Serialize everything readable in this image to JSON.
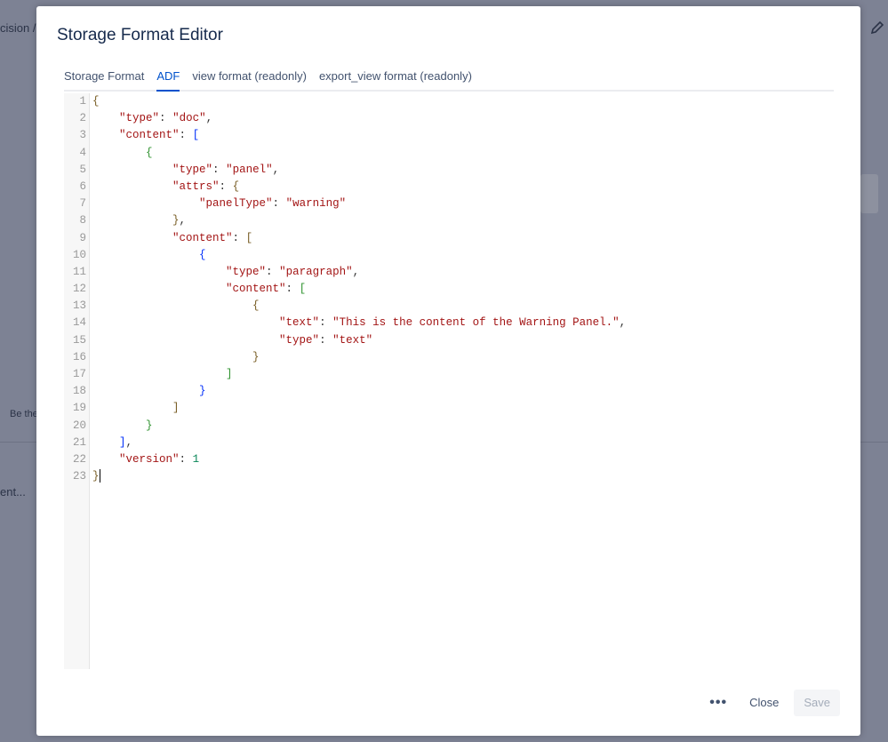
{
  "background": {
    "breadcrumb_fragment": "cision  /",
    "comment_prompt": "Be the",
    "content_fragment": "ent..."
  },
  "modal": {
    "title": "Storage Format Editor",
    "tabs": [
      {
        "label": "Storage Format",
        "active": false
      },
      {
        "label": "ADF",
        "active": true
      },
      {
        "label": "view format (readonly)",
        "active": false
      },
      {
        "label": "export_view format (readonly)",
        "active": false
      }
    ],
    "editor": {
      "lines": [
        "{",
        "    \"type\": \"doc\",",
        "    \"content\": [",
        "        {",
        "            \"type\": \"panel\",",
        "            \"attrs\": {",
        "                \"panelType\": \"warning\"",
        "            },",
        "            \"content\": [",
        "                {",
        "                    \"type\": \"paragraph\",",
        "                    \"content\": [",
        "                        {",
        "                            \"text\": \"This is the content of the Warning Panel.\",",
        "                            \"type\": \"text\"",
        "                        }",
        "                    ]",
        "                }",
        "            ]",
        "        }",
        "    ],",
        "    \"version\": 1",
        "}"
      ]
    },
    "footer": {
      "more_icon": "ellipsis-icon",
      "more_label": "•••",
      "close_label": "Close",
      "save_label": "Save"
    },
    "colors": {
      "accent": "#0052cc",
      "string": "#a31515",
      "number": "#098658"
    }
  }
}
